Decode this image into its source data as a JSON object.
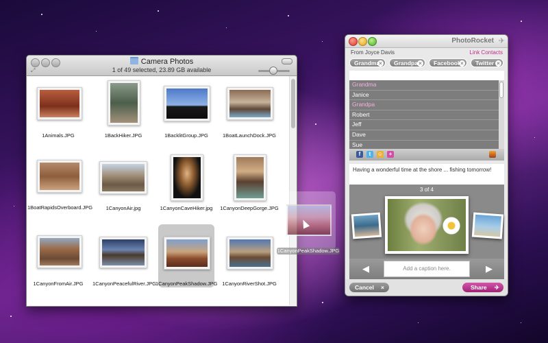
{
  "finder": {
    "title": "Camera Photos",
    "status": "1 of 49 selected, 23.89 GB available",
    "files": [
      {
        "name": "1Animals.JPG",
        "selected": false
      },
      {
        "name": "1BackHiker.JPG",
        "selected": false
      },
      {
        "name": "1BacklitGroup.JPG",
        "selected": false
      },
      {
        "name": "1BoatLaunchDock.JPG",
        "selected": false
      },
      {
        "name": "1BoatRapidsOverboard.JPG",
        "selected": false
      },
      {
        "name": "1CanyonAir.jpg",
        "selected": false
      },
      {
        "name": "1CanyonCaveHiker.jpg",
        "selected": false
      },
      {
        "name": "1CanyonDeepGorge.JPG",
        "selected": false
      },
      {
        "name": "1CanyonFromAir.JPG",
        "selected": false
      },
      {
        "name": "1CanyonPeacefulRiver.JPG",
        "selected": false
      },
      {
        "name": "1CanyonPeakShadow.JPG",
        "selected": true
      },
      {
        "name": "1CanyonRiverShot.JPG",
        "selected": false
      }
    ]
  },
  "drag": {
    "label": "1CanyonPeakShadow.JPG"
  },
  "photorocket": {
    "brand": "PhotoRocket",
    "from": "From Joyce Davis",
    "link_contacts": "Link Contacts",
    "tags": [
      "Grandma",
      "Grandpa",
      "Facebook",
      "Twitter"
    ],
    "contacts": [
      {
        "name": "Grandma",
        "highlight": true
      },
      {
        "name": "Janice",
        "highlight": false
      },
      {
        "name": "Grandpa",
        "highlight": true
      },
      {
        "name": "Robert",
        "highlight": false
      },
      {
        "name": "Jeff",
        "highlight": false
      },
      {
        "name": "Dave",
        "highlight": false
      },
      {
        "name": "Sue",
        "highlight": false
      }
    ],
    "message": "Having a wonderful time at the shore ... fishing tomorrow!",
    "counter": "3 of 4",
    "caption_placeholder": "Add a caption here.",
    "cancel_label": "Cancel",
    "share_label": "Share",
    "accent_color": "#c02c8a"
  }
}
